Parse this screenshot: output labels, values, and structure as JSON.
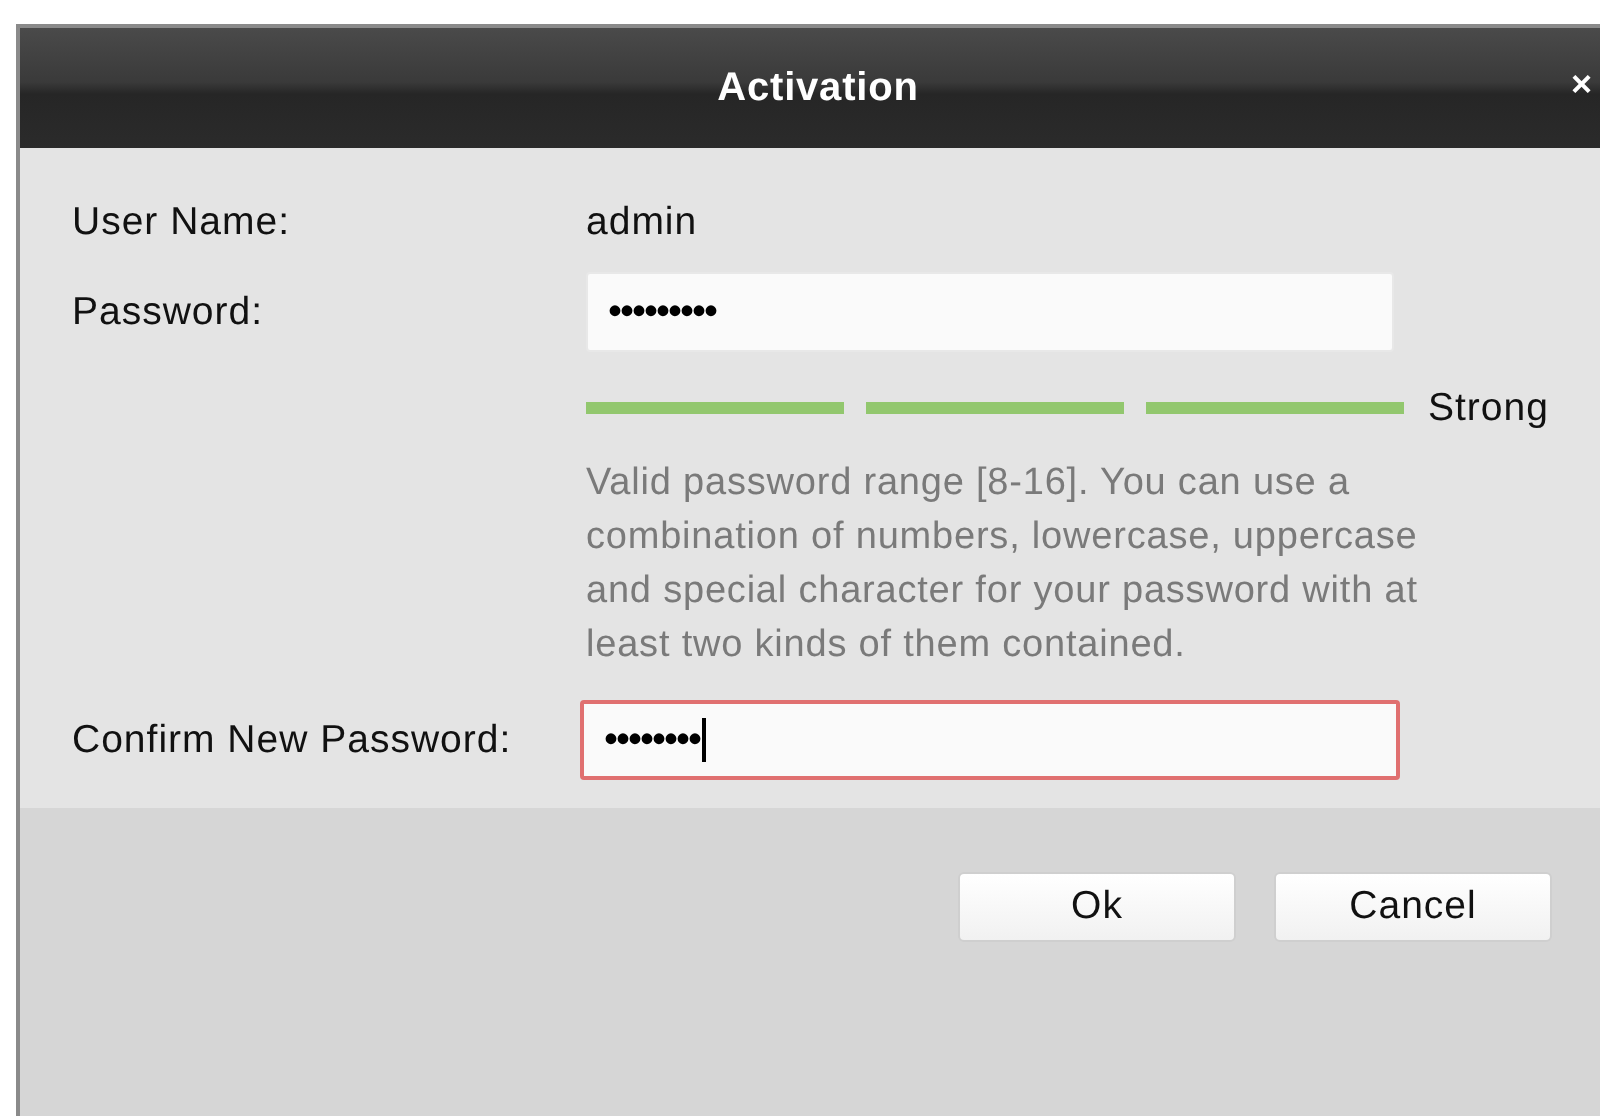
{
  "dialog": {
    "title": "Activation",
    "close": "×"
  },
  "user_name": {
    "label": "User Name:",
    "value": "admin"
  },
  "password": {
    "label": "Password:",
    "value": "•••••••••"
  },
  "strength": {
    "level": 1,
    "label": "Strong"
  },
  "hint": "Valid password range [8-16]. You can use a combination of numbers, lowercase, uppercase and special character for your password with at least two kinds of them contained.",
  "confirm": {
    "label": "Confirm New Password:",
    "value": "••••••••",
    "error": true,
    "focused": true
  },
  "buttons": [
    {
      "label": "Ok"
    },
    {
      "label": "Cancel"
    }
  ]
}
